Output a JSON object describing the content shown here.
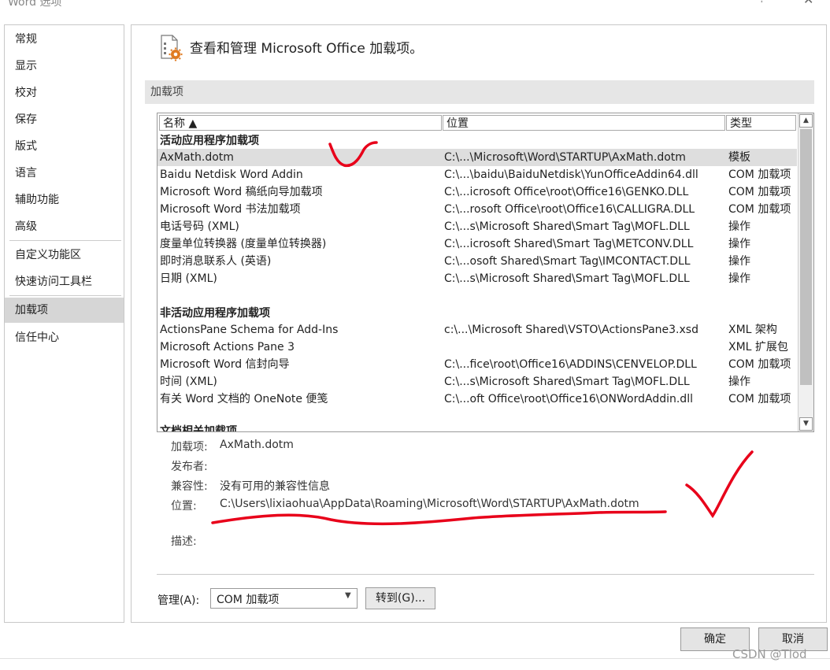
{
  "window": {
    "title": "Word 选项",
    "help": "?",
    "close": "✕"
  },
  "sidebar": {
    "items": [
      {
        "label": "常规"
      },
      {
        "label": "显示"
      },
      {
        "label": "校对"
      },
      {
        "label": "保存"
      },
      {
        "label": "版式"
      },
      {
        "label": "语言"
      },
      {
        "label": "辅助功能"
      },
      {
        "label": "高级"
      },
      {
        "label": "自定义功能区"
      },
      {
        "label": "快速访问工具栏"
      },
      {
        "label": "加载项",
        "selected": true
      },
      {
        "label": "信任中心"
      }
    ]
  },
  "header": {
    "title": "查看和管理 Microsoft Office 加载项。",
    "icon": "addin-gear-icon"
  },
  "section": {
    "title": "加载项"
  },
  "addins_table": {
    "columns": [
      "名称 ▲",
      "位置",
      "类型"
    ],
    "groups": [
      {
        "title": "活动应用程序加载项",
        "rows": [
          {
            "name": "AxMath.dotm",
            "location": "C:\\...\\Microsoft\\Word\\STARTUP\\AxMath.dotm",
            "type": "模板",
            "selected": true
          },
          {
            "name": "Baidu Netdisk Word Addin",
            "location": "C:\\...\\baidu\\BaiduNetdisk\\YunOfficeAddin64.dll",
            "type": "COM 加载项"
          },
          {
            "name": "Microsoft Word 稿纸向导加载项",
            "location": "C:\\...icrosoft Office\\root\\Office16\\GENKO.DLL",
            "type": "COM 加载项"
          },
          {
            "name": "Microsoft Word 书法加载项",
            "location": "C:\\...rosoft Office\\root\\Office16\\CALLIGRA.DLL",
            "type": "COM 加载项"
          },
          {
            "name": "电话号码 (XML)",
            "location": "C:\\...s\\Microsoft Shared\\Smart Tag\\MOFL.DLL",
            "type": "操作"
          },
          {
            "name": "度量单位转换器 (度量单位转换器)",
            "location": "C:\\...icrosoft Shared\\Smart Tag\\METCONV.DLL",
            "type": "操作"
          },
          {
            "name": "即时消息联系人 (英语)",
            "location": "C:\\...osoft Shared\\Smart Tag\\IMCONTACT.DLL",
            "type": "操作"
          },
          {
            "name": "日期 (XML)",
            "location": "C:\\...s\\Microsoft Shared\\Smart Tag\\MOFL.DLL",
            "type": "操作"
          }
        ]
      },
      {
        "title": "非活动应用程序加载项",
        "rows": [
          {
            "name": "ActionsPane Schema for Add-Ins",
            "location": "c:\\...\\Microsoft Shared\\VSTO\\ActionsPane3.xsd",
            "type": "XML 架构"
          },
          {
            "name": "Microsoft Actions Pane 3",
            "location": "",
            "type": "XML 扩展包"
          },
          {
            "name": "Microsoft Word 信封向导",
            "location": "C:\\...fice\\root\\Office16\\ADDINS\\CENVELOP.DLL",
            "type": "COM 加载项"
          },
          {
            "name": "时间 (XML)",
            "location": "C:\\...s\\Microsoft Shared\\Smart Tag\\MOFL.DLL",
            "type": "操作"
          },
          {
            "name": "有关 Word 文档的 OneNote 便笺",
            "location": "C:\\...oft Office\\root\\Office16\\ONWordAddin.dll",
            "type": "COM 加载项"
          }
        ]
      },
      {
        "title": "文档相关加载项",
        "rows": []
      }
    ]
  },
  "details": {
    "addin_label": "加载项:",
    "addin_value": "AxMath.dotm",
    "publisher_label": "发布者:",
    "publisher_value": "",
    "compat_label": "兼容性:",
    "compat_value": "没有可用的兼容性信息",
    "location_label": "位置:",
    "location_value": "C:\\Users\\lixiaohua\\AppData\\Roaming\\Microsoft\\Word\\STARTUP\\AxMath.dotm",
    "description_label": "描述:",
    "description_value": ""
  },
  "manage": {
    "label": "管理(A):",
    "selected": "COM 加载项",
    "goto_label": "转到(G)..."
  },
  "footer": {
    "ok": "确定",
    "cancel": "取消"
  },
  "watermark": "CSDN @Tlod",
  "colors": {
    "annotation_red": "#e8001a",
    "selected_row": "#dedede",
    "selected_nav": "#d6d6d6"
  }
}
